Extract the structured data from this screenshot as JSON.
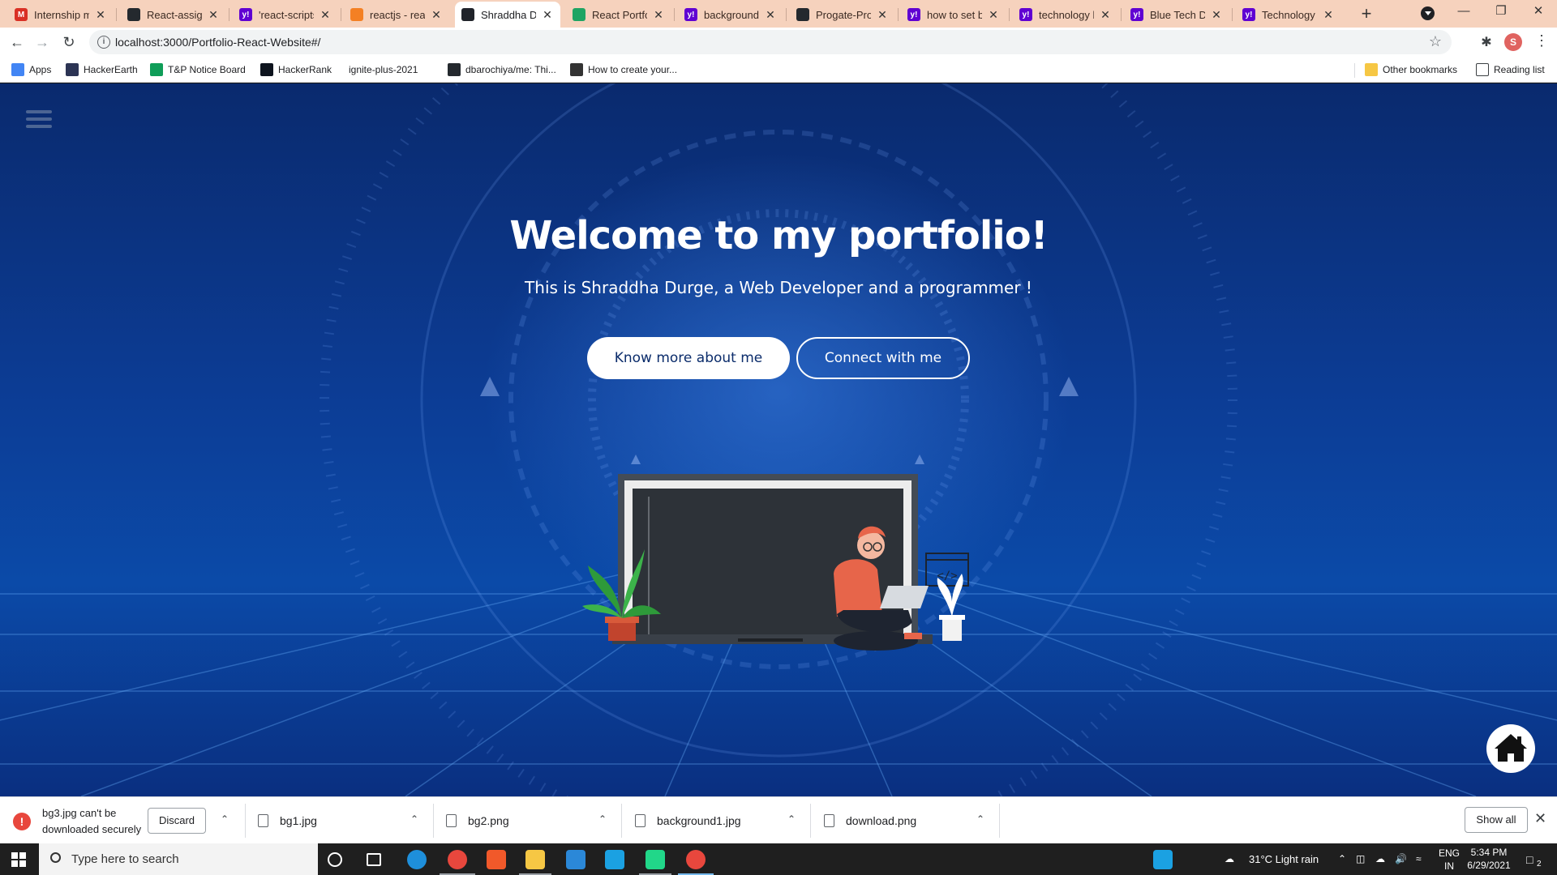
{
  "browser": {
    "tabs": [
      {
        "title": "Internship me",
        "icon": "gmail-icon",
        "color": "#d93025",
        "glyph": "M"
      },
      {
        "title": "React-assignm",
        "icon": "github-icon",
        "color": "#24292e",
        "glyph": ""
      },
      {
        "title": "'react-scripts'",
        "icon": "yahoo-icon",
        "color": "#6001d2",
        "glyph": "y!"
      },
      {
        "title": "reactjs - react",
        "icon": "stackoverflow-icon",
        "color": "#f48024",
        "glyph": ""
      },
      {
        "title": "Shraddha Dur",
        "icon": "react-icon",
        "color": "#20232a",
        "glyph": ""
      },
      {
        "title": "React Portfoli",
        "icon": "google-drive-icon",
        "color": "#1fa463",
        "glyph": ""
      },
      {
        "title": "background c",
        "icon": "yahoo-icon",
        "color": "#6001d2",
        "glyph": "y!"
      },
      {
        "title": "Progate-Proje",
        "icon": "github-icon",
        "color": "#24292e",
        "glyph": ""
      },
      {
        "title": "how to set ba",
        "icon": "yahoo-icon",
        "color": "#6001d2",
        "glyph": "y!"
      },
      {
        "title": "technology b",
        "icon": "yahoo-icon",
        "color": "#6001d2",
        "glyph": "y!"
      },
      {
        "title": "Blue Tech Dig",
        "icon": "yahoo-icon",
        "color": "#6001d2",
        "glyph": "y!"
      },
      {
        "title": "Technology B",
        "icon": "yahoo-icon",
        "color": "#6001d2",
        "glyph": "y!"
      }
    ],
    "active_tab": 4,
    "url": "localhost:3000/Portfolio-React-Website#/",
    "bookmarks": [
      {
        "label": "Apps",
        "icon": "apps-grid-icon",
        "color": "#4285f4"
      },
      {
        "label": "HackerEarth",
        "icon": "hackerearth-icon",
        "color": "#2c3454"
      },
      {
        "label": "T&P Notice Board",
        "icon": "notice-board-icon",
        "color": "#0f9d58"
      },
      {
        "label": "HackerRank",
        "icon": "hackerrank-icon",
        "color": "#0e141e"
      },
      {
        "label": "ignite-plus-2021",
        "icon": "",
        "color": ""
      },
      {
        "label": "dbarochiya/me: Thi...",
        "icon": "github-icon",
        "color": "#24292e"
      },
      {
        "label": "How to create your...",
        "icon": "medium-icon",
        "color": "#333333"
      }
    ],
    "other_bookmarks": "Other bookmarks",
    "reading_list": "Reading list",
    "profile_initial": "S"
  },
  "hero": {
    "title": "Welcome to my portfolio!",
    "subtitle": "This is Shraddha Durge, a Web Developer and a programmer !",
    "primary_button": "Know more about me",
    "secondary_button": "Connect with me",
    "illustration_code_tag": "</>"
  },
  "downloads": {
    "warning": "bg3.jpg can't be downloaded securely",
    "discard": "Discard",
    "files": [
      "bg1.jpg",
      "bg2.png",
      "background1.jpg",
      "download.png"
    ],
    "show_all": "Show all"
  },
  "taskbar": {
    "search_placeholder": "Type here to search",
    "weather": "31°C  Light rain",
    "language_line1": "ENG",
    "language_line2": "IN",
    "time": "5:34 PM",
    "date": "6/29/2021",
    "notification_count": "2"
  },
  "colors": {
    "tab_strip": "#f6d2bd",
    "page_bg_dark": "#0a2a6e",
    "page_bg_light": "#0b4aa8",
    "button_text": "#0b2c6b",
    "taskbar": "#1f1f1f"
  }
}
